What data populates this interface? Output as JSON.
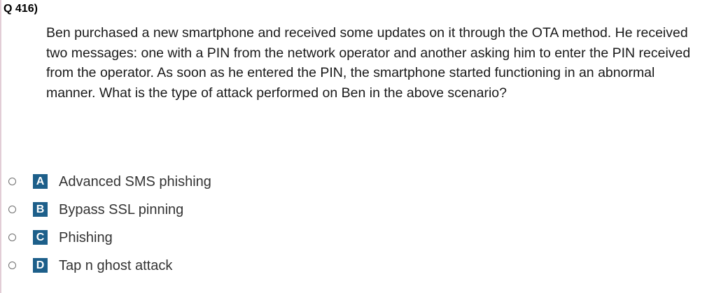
{
  "question": {
    "number": "Q 416)",
    "text": "Ben purchased a new smartphone and received some updates on it through the OTA method. He received two messages: one with a PIN from the network operator and another asking him to enter the PIN received from the operator. As soon as he entered the PIN, the smartphone started functioning in an abnormal manner. What is the type of attack performed on Ben in the above scenario?"
  },
  "options": [
    {
      "letter": "A",
      "text": "Advanced SMS phishing"
    },
    {
      "letter": "B",
      "text": "Bypass SSL pinning"
    },
    {
      "letter": "C",
      "text": "Phishing"
    },
    {
      "letter": "D",
      "text": "Tap n ghost attack"
    }
  ],
  "colors": {
    "badge": "#1d5f8a",
    "option_text": "#333333",
    "left_rule": "#e2cdd6"
  }
}
